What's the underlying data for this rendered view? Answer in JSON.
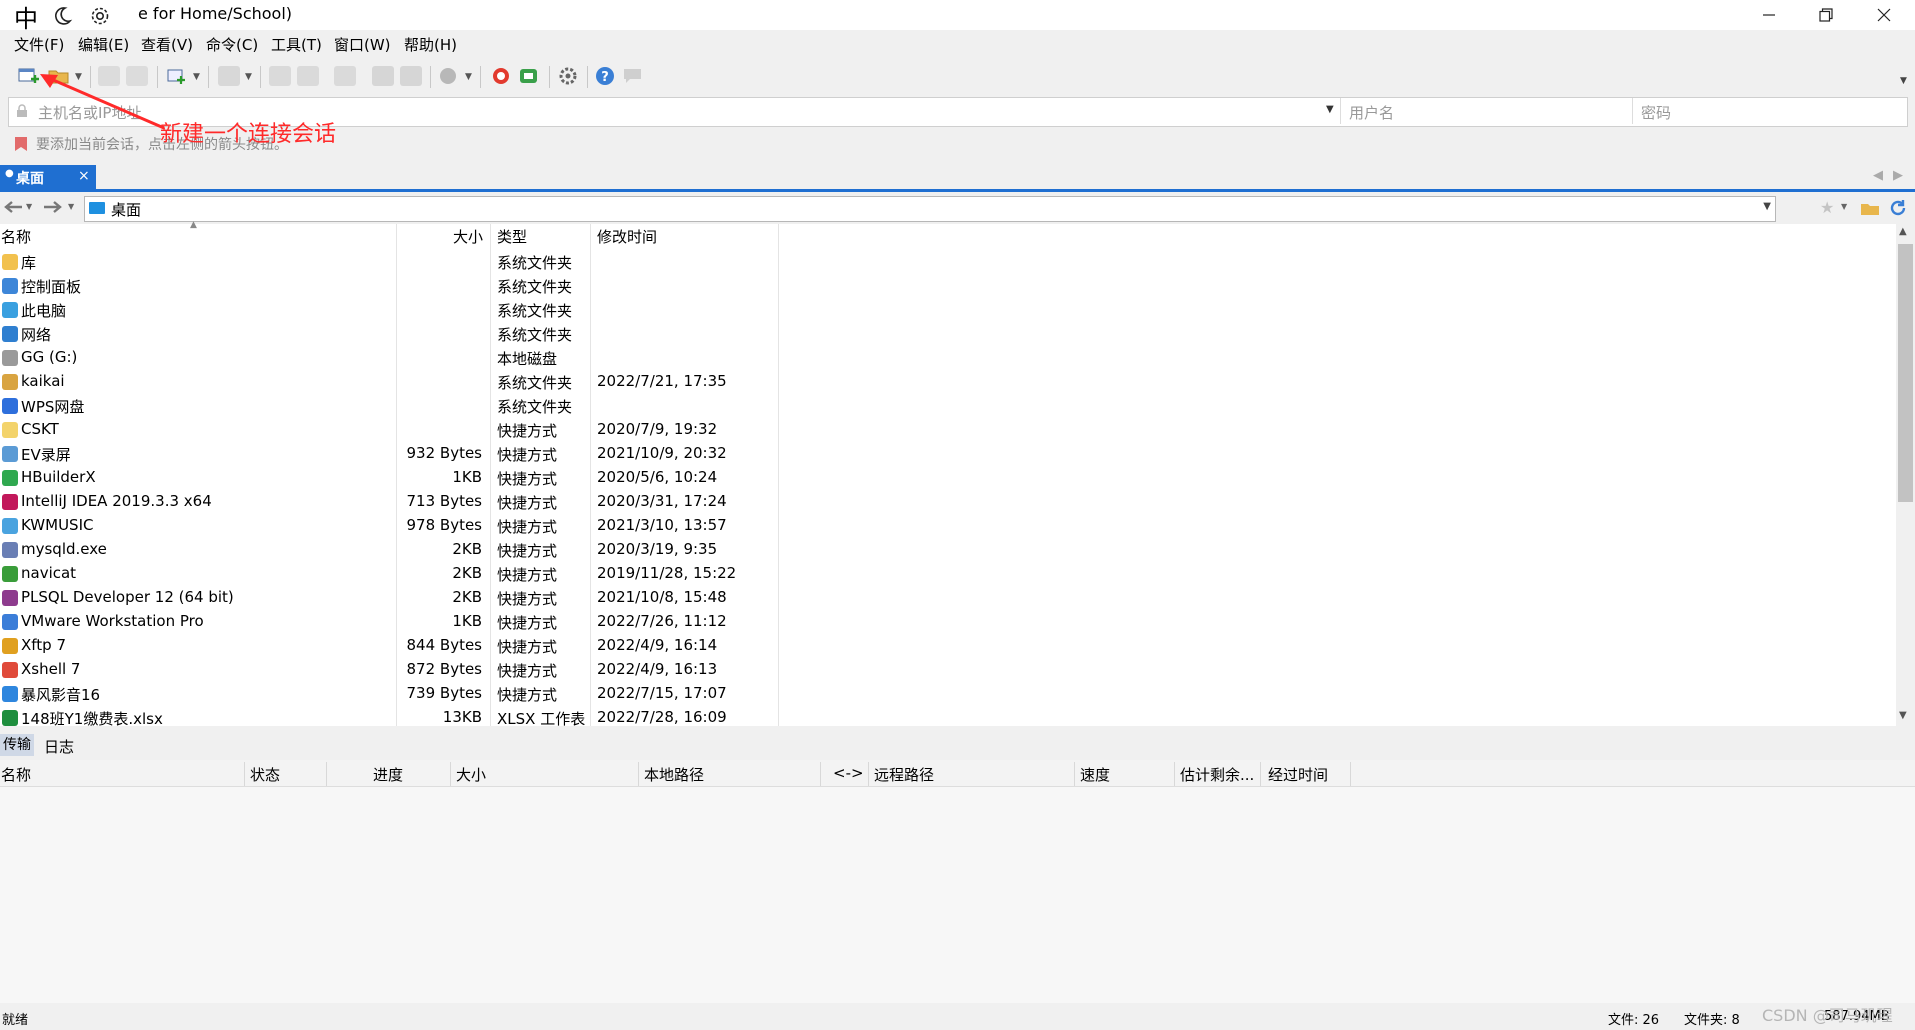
{
  "titlebar": {
    "ime_lang": "中",
    "title": "e for Home/School)"
  },
  "menu": [
    "文件(F)",
    "编辑(E)",
    "查看(V)",
    "命令(C)",
    "工具(T)",
    "窗口(W)",
    "帮助(H)"
  ],
  "address": {
    "host_placeholder": "主机名或IP地址",
    "user_placeholder": "用户名",
    "password_placeholder": "密码"
  },
  "hint": "要添加当前会话，点击左侧的箭头按钮。",
  "annotation": "新建一个连接会话",
  "tabs": {
    "active": "桌面",
    "close": "×"
  },
  "path": "桌面",
  "columns": {
    "name": "名称",
    "size": "大小",
    "type": "类型",
    "modified": "修改时间"
  },
  "files": [
    {
      "name": "库",
      "size": "",
      "type": "系统文件夹",
      "modified": "",
      "icon": "library-icon",
      "color": "#f2c14e"
    },
    {
      "name": "控制面板",
      "size": "",
      "type": "系统文件夹",
      "modified": "",
      "icon": "control-panel-icon",
      "color": "#3d86d8"
    },
    {
      "name": "此电脑",
      "size": "",
      "type": "系统文件夹",
      "modified": "",
      "icon": "computer-icon",
      "color": "#3aa0e0"
    },
    {
      "name": "网络",
      "size": "",
      "type": "系统文件夹",
      "modified": "",
      "icon": "network-icon",
      "color": "#2f7fd0"
    },
    {
      "name": "GG (G:)",
      "size": "",
      "type": "本地磁盘",
      "modified": "",
      "icon": "drive-icon",
      "color": "#9a9a9a"
    },
    {
      "name": "kaikai",
      "size": "",
      "type": "系统文件夹",
      "modified": "2022/7/21, 17:35",
      "icon": "user-folder-icon",
      "color": "#d9a441"
    },
    {
      "name": "WPS网盘",
      "size": "",
      "type": "系统文件夹",
      "modified": "",
      "icon": "cloud-icon",
      "color": "#2e6fdc"
    },
    {
      "name": "CSKT",
      "size": "",
      "type": "快捷方式",
      "modified": "2020/7/9, 19:32",
      "icon": "shortcut-icon",
      "color": "#f3d36b"
    },
    {
      "name": "EV录屏",
      "size": "932 Bytes",
      "type": "快捷方式",
      "modified": "2021/10/9, 20:32",
      "icon": "shortcut-icon",
      "color": "#5b9bd5"
    },
    {
      "name": "HBuilderX",
      "size": "1KB",
      "type": "快捷方式",
      "modified": "2020/5/6, 10:24",
      "icon": "hbuilder-icon",
      "color": "#2fa84f"
    },
    {
      "name": "IntelliJ IDEA 2019.3.3 x64",
      "size": "713 Bytes",
      "type": "快捷方式",
      "modified": "2020/3/31, 17:24",
      "icon": "intellij-icon",
      "color": "#c2185b"
    },
    {
      "name": "KWMUSIC",
      "size": "978 Bytes",
      "type": "快捷方式",
      "modified": "2021/3/10, 13:57",
      "icon": "music-icon",
      "color": "#4aa3df"
    },
    {
      "name": "mysqld.exe",
      "size": "2KB",
      "type": "快捷方式",
      "modified": "2020/3/19, 9:35",
      "icon": "exe-icon",
      "color": "#6a7fb5"
    },
    {
      "name": "navicat",
      "size": "2KB",
      "type": "快捷方式",
      "modified": "2019/11/28, 15:22",
      "icon": "navicat-icon",
      "color": "#3a9d3a"
    },
    {
      "name": "PLSQL Developer 12 (64 bit)",
      "size": "2KB",
      "type": "快捷方式",
      "modified": "2021/10/8, 15:48",
      "icon": "plsql-icon",
      "color": "#8e3b8e"
    },
    {
      "name": "VMware Workstation Pro",
      "size": "1KB",
      "type": "快捷方式",
      "modified": "2022/7/26, 11:12",
      "icon": "vmware-icon",
      "color": "#3b7dd8"
    },
    {
      "name": "Xftp 7",
      "size": "844 Bytes",
      "type": "快捷方式",
      "modified": "2022/4/9, 16:14",
      "icon": "xftp-icon",
      "color": "#e0a020"
    },
    {
      "name": "Xshell 7",
      "size": "872 Bytes",
      "type": "快捷方式",
      "modified": "2022/4/9, 16:13",
      "icon": "xshell-icon",
      "color": "#e04a3a"
    },
    {
      "name": "暴风影音16",
      "size": "739 Bytes",
      "type": "快捷方式",
      "modified": "2022/7/15, 17:07",
      "icon": "player-icon",
      "color": "#2e86de"
    },
    {
      "name": "148班Y1缴费表.xlsx",
      "size": "13KB",
      "type": "XLSX 工作表",
      "modified": "2022/7/28, 16:09",
      "icon": "excel-icon",
      "color": "#1e8e3e"
    }
  ],
  "transfer": {
    "tabs": [
      "传输",
      "日志"
    ],
    "columns": [
      "名称",
      "状态",
      "进度",
      "大小",
      "本地路径",
      "<->",
      "远程路径",
      "速度",
      "估计剩余...",
      "经过时间"
    ]
  },
  "status": {
    "left": "就绪",
    "files": "文件: 26",
    "folders": "文件夹: 8",
    "free": "587.94MB",
    "watermark": "CSDN @司马玑瑆"
  }
}
